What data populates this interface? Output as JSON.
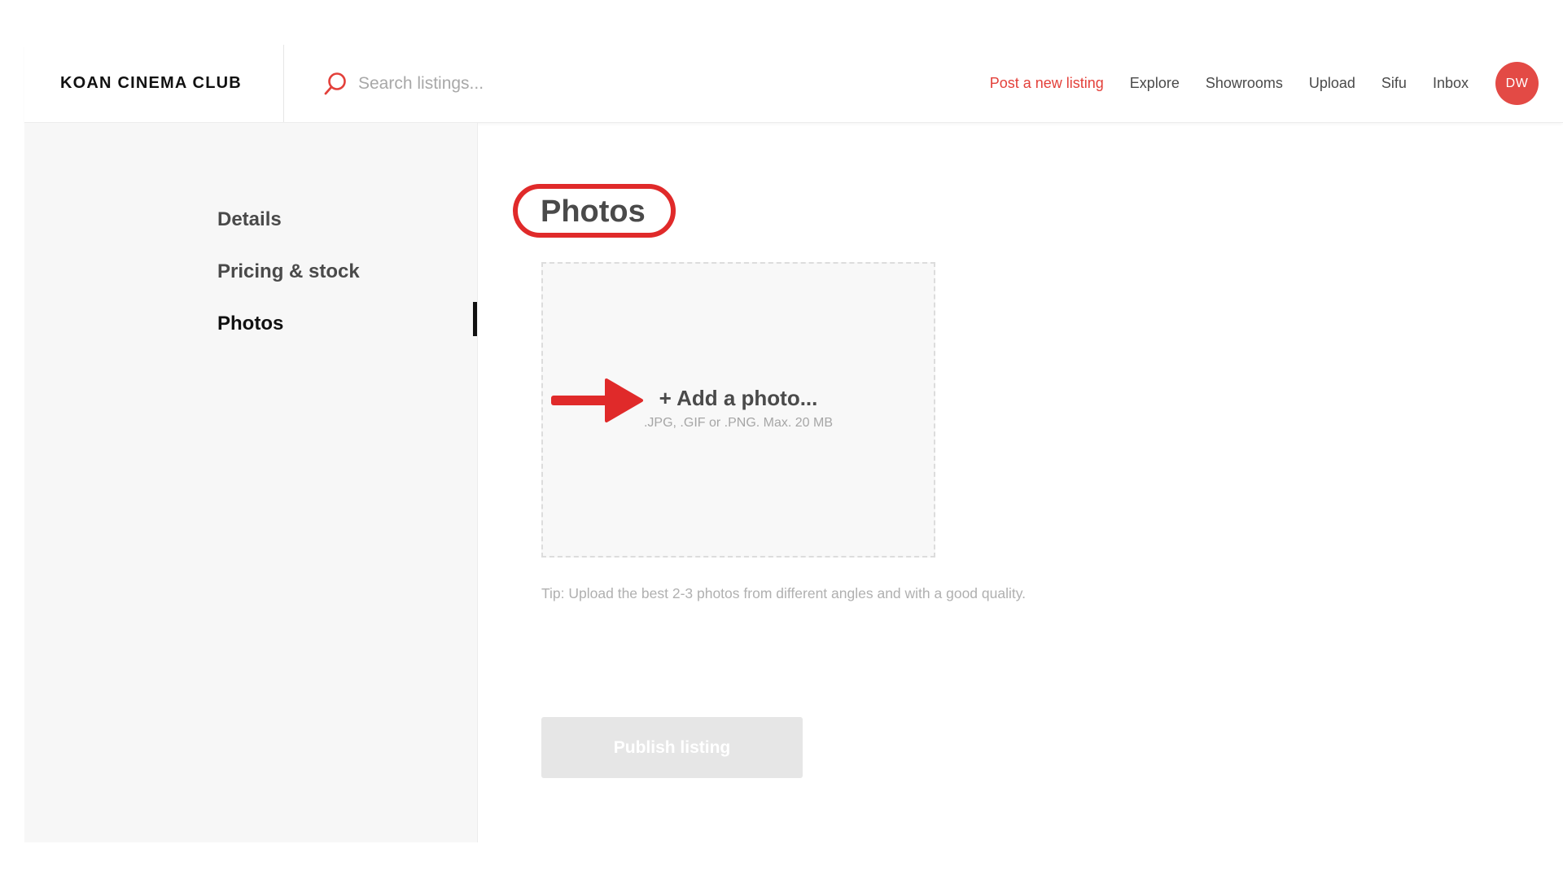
{
  "header": {
    "logo": "KOAN CINEMA CLUB",
    "search_placeholder": "Search listings...",
    "search_icon": "search-icon",
    "nav": {
      "post_listing": "Post a new listing",
      "explore": "Explore",
      "showrooms": "Showrooms",
      "upload": "Upload",
      "sifu": "Sifu",
      "inbox": "Inbox"
    },
    "avatar_initials": "DW",
    "accent_color": "#e3403a"
  },
  "sidebar": {
    "items": [
      {
        "label": "Details",
        "active": false
      },
      {
        "label": "Pricing & stock",
        "active": false
      },
      {
        "label": "Photos",
        "active": true
      }
    ]
  },
  "main": {
    "title": "Photos",
    "upload": {
      "label": "+ Add a photo...",
      "hint": ".JPG, .GIF or .PNG. Max. 20 MB"
    },
    "tip": "Tip: Upload the best 2-3 photos from different angles and with a good quality.",
    "publish_label": "Publish listing",
    "publish_disabled": true
  },
  "annotations": {
    "highlight_color": "#e02a2a",
    "arrow_icon": "arrow-right-icon"
  }
}
